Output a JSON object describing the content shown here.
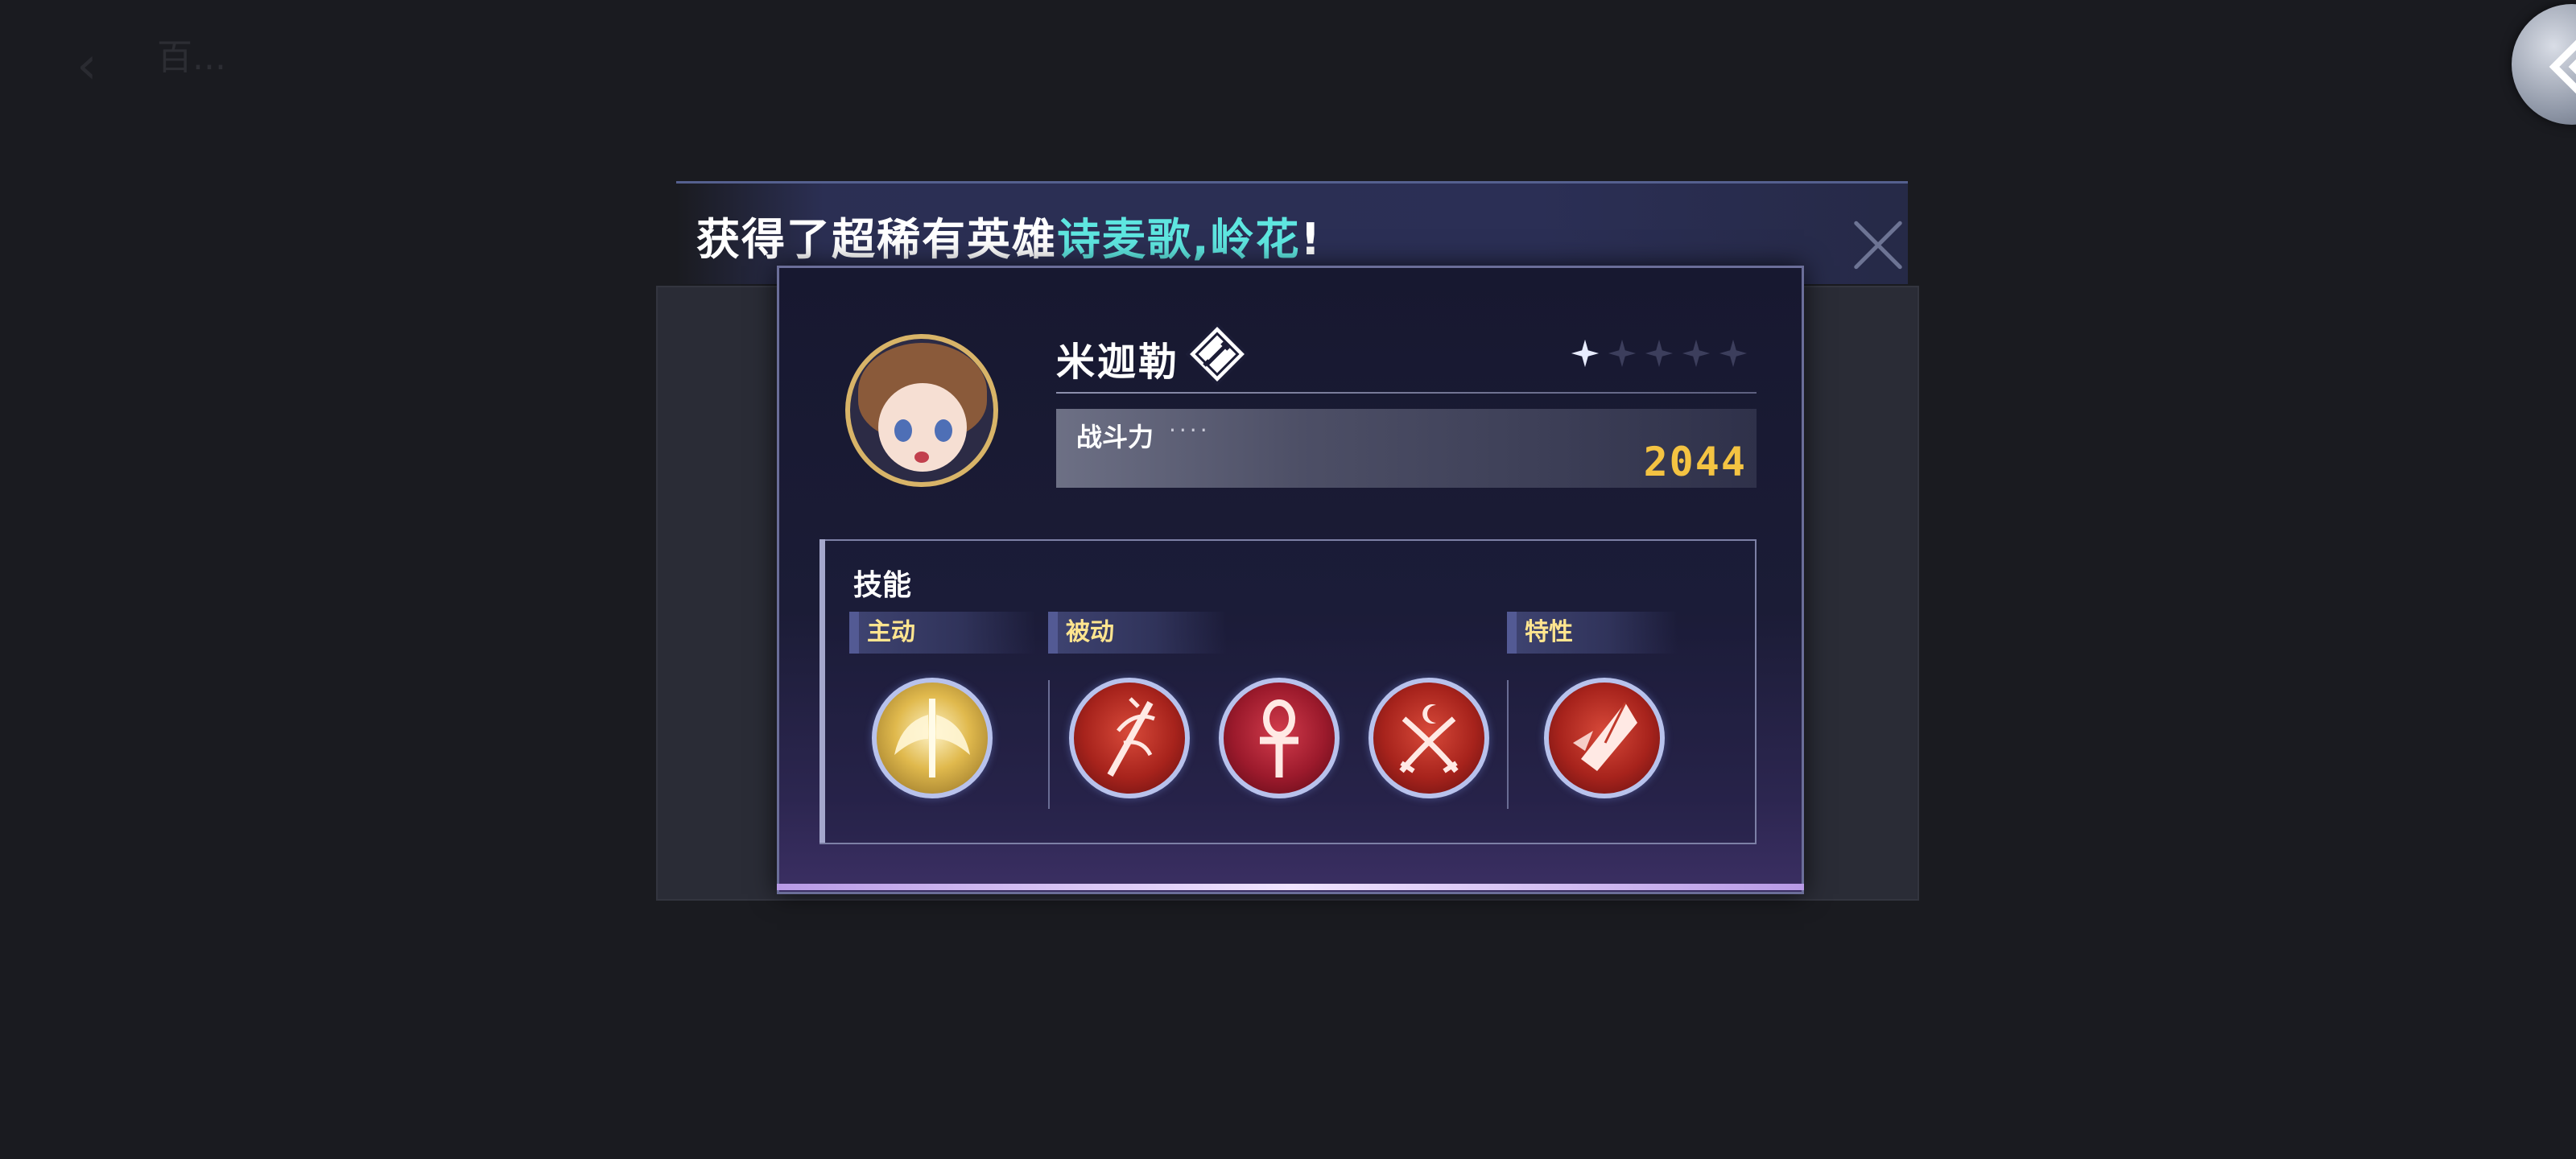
{
  "background": {
    "title": "百..."
  },
  "dialog": {
    "title_prefix": "获得了超稀有英雄",
    "title_highlight": "诗麦歌,岭花",
    "title_suffix": "!",
    "hero": {
      "name": "米迦勒",
      "class_icon": "sword-shield-icon",
      "stars_total": 5,
      "stars_filled": 1,
      "power_label": "战斗力",
      "power_dots": "····",
      "power_value": "2044"
    },
    "skills": {
      "title": "技能",
      "active_label": "主动",
      "passive_label": "被动",
      "trait_label": "特性",
      "active": [
        {
          "icon": "angel-wings-icon"
        }
      ],
      "passive": [
        {
          "icon": "thorn-staff-icon"
        },
        {
          "icon": "ankh-icon"
        },
        {
          "icon": "crossed-swords-moon-icon"
        }
      ],
      "trait": [
        {
          "icon": "crystal-shard-icon"
        }
      ]
    }
  },
  "colors": {
    "highlight": "#5ee6e0",
    "power": "#f4c342",
    "tag_text": "#ffe58f"
  }
}
